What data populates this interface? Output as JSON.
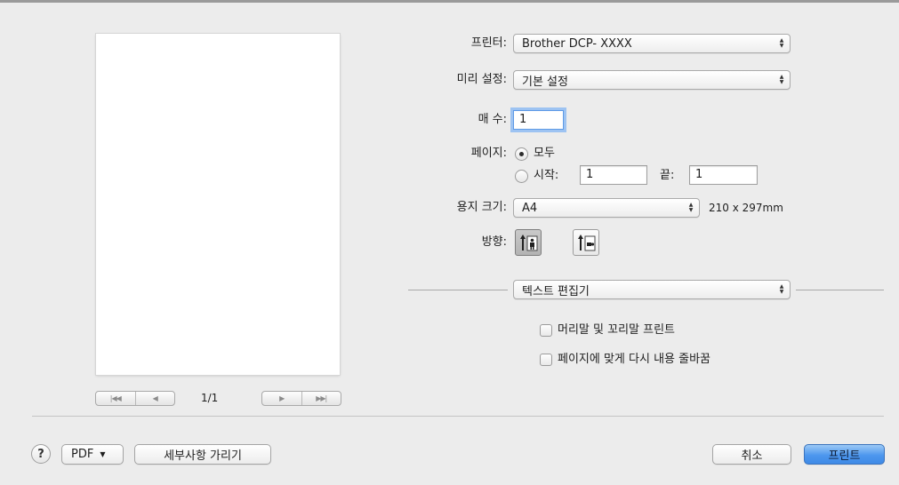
{
  "preview": {
    "page_count": "1/1",
    "first_label": "|◀◀",
    "prev_label": "◀",
    "next_label": "▶",
    "last_label": "▶▶|"
  },
  "printer": {
    "label": "프린터:",
    "value": "Brother DCP- XXXX"
  },
  "presets": {
    "label": "미리 설정:",
    "value": "기본 설정"
  },
  "copies": {
    "label": "매 수:",
    "value": "1"
  },
  "pages": {
    "label": "페이지:",
    "all_label": "모두",
    "all_selected": true,
    "from_label": "시작:",
    "from_value": "1",
    "to_label": "끝:",
    "to_value": "1"
  },
  "paper_size": {
    "label": "용지 크기:",
    "value": "A4",
    "dimensions": "210 x 297mm"
  },
  "orientation": {
    "label": "방향:",
    "selected": "portrait"
  },
  "app_section": {
    "value": "텍스트 편집기"
  },
  "options": {
    "header_footer": {
      "label": "머리말 및 꼬리말 프린트",
      "checked": false
    },
    "rewrap": {
      "label": "페이지에 맞게 다시 내용 줄바꿈",
      "checked": false
    }
  },
  "footer": {
    "help_label": "?",
    "pdf_label": "PDF",
    "pdf_arrow": "▼",
    "hide_details_label": "세부사항 가리기",
    "cancel_label": "취소",
    "print_label": "프린트"
  },
  "colors": {
    "default_button": "#4d97ee",
    "focus_ring": "#9dc3f2"
  }
}
